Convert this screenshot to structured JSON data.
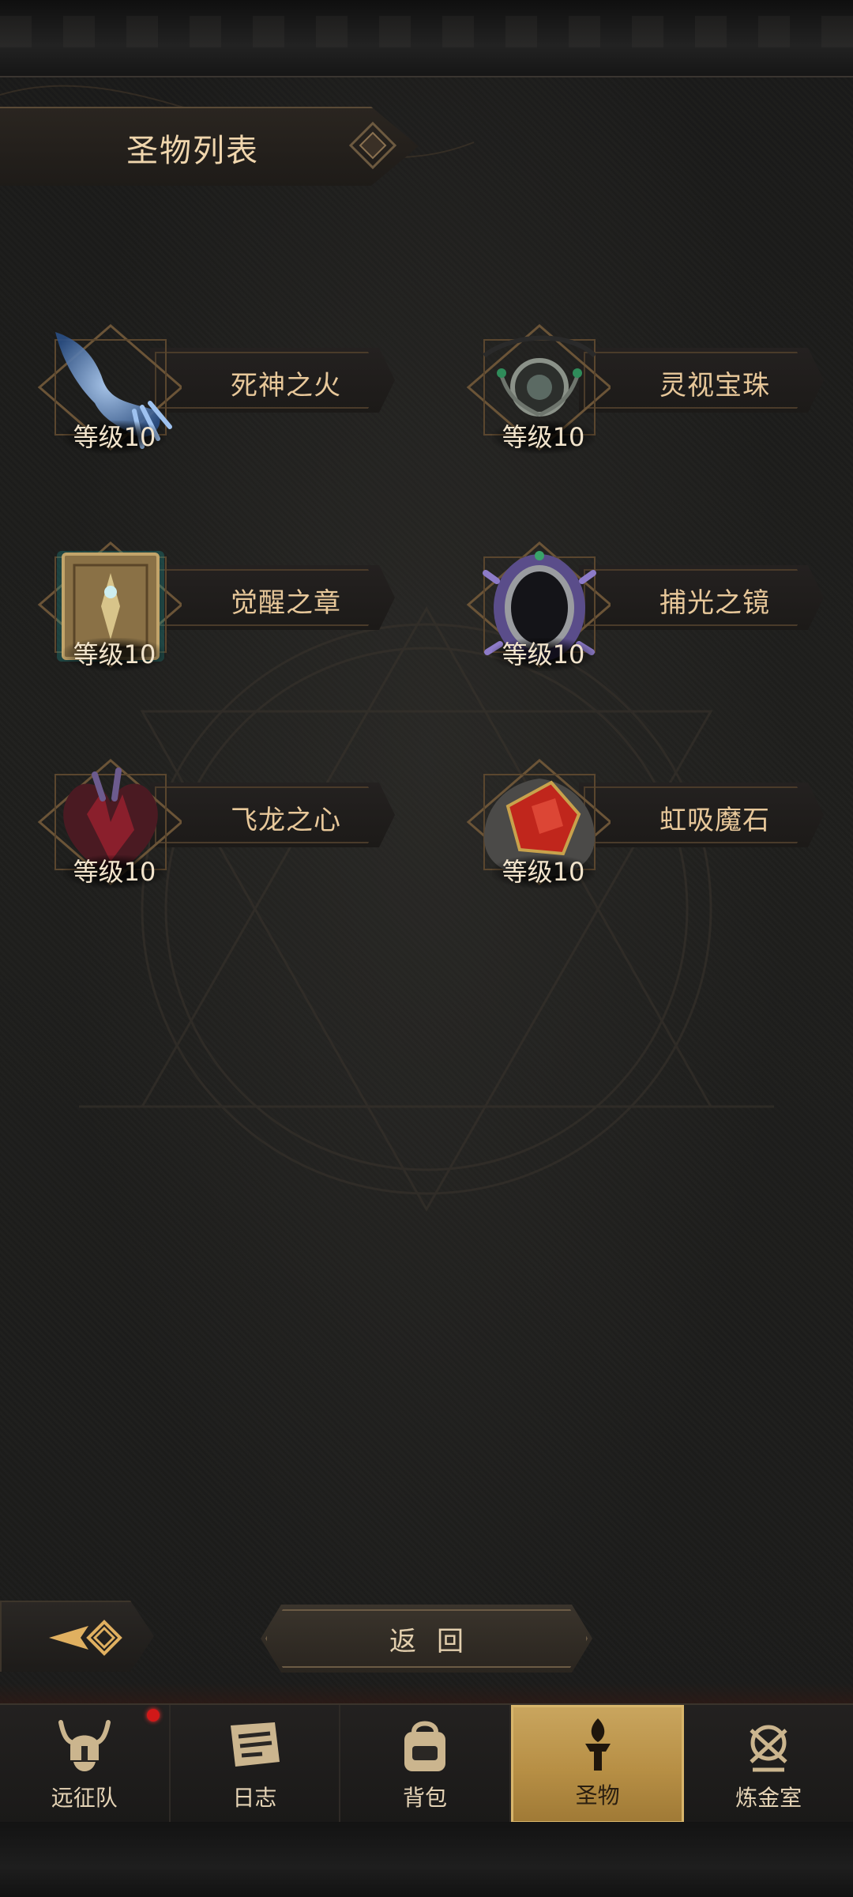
{
  "header": {
    "title": "圣物列表"
  },
  "relics": [
    {
      "name": "死神之火",
      "level": "等级10"
    },
    {
      "name": "灵视宝珠",
      "level": "等级10"
    },
    {
      "name": "觉醒之章",
      "level": "等级10"
    },
    {
      "name": "捕光之镜",
      "level": "等级10"
    },
    {
      "name": "飞龙之心",
      "level": "等级10"
    },
    {
      "name": "虹吸魔石",
      "level": "等级10"
    }
  ],
  "actions": {
    "back_label": "返回"
  },
  "nav": {
    "items": [
      {
        "label": "远征队",
        "icon": "viking-helmet-icon"
      },
      {
        "label": "日志",
        "icon": "scroll-icon"
      },
      {
        "label": "背包",
        "icon": "backpack-icon"
      },
      {
        "label": "圣物",
        "icon": "torch-icon",
        "active": true
      },
      {
        "label": "炼金室",
        "icon": "alchemy-icon"
      }
    ]
  },
  "colors": {
    "accent": "#c9a55e",
    "text": "#e8c89a",
    "badge": "#d11818"
  }
}
